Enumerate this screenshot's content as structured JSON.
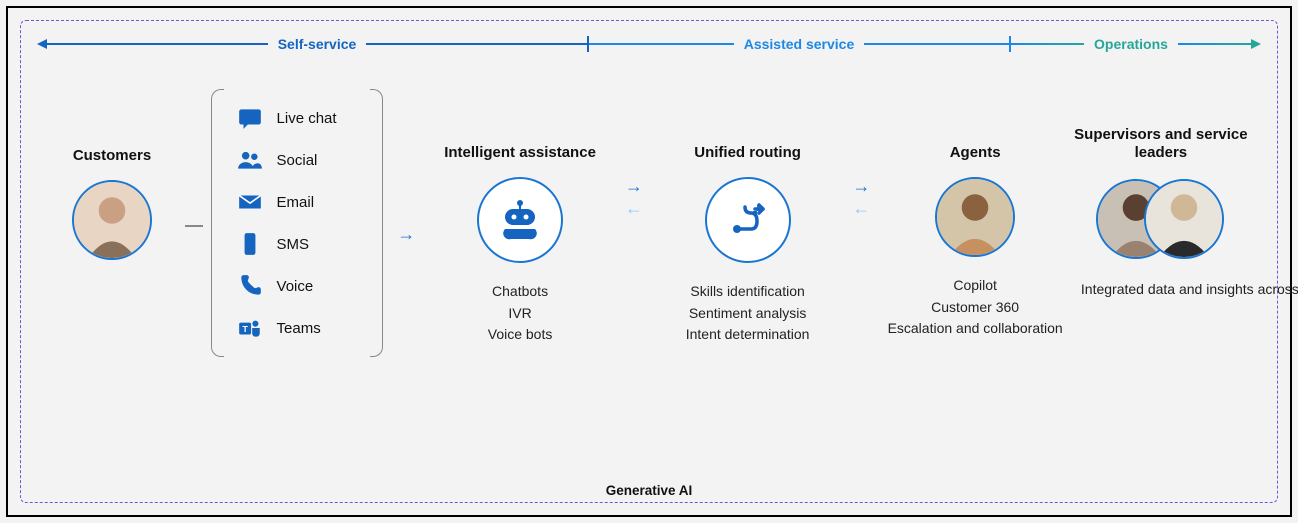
{
  "header": {
    "self_service": "Self-service",
    "assisted_service": "Assisted service",
    "operations": "Operations"
  },
  "customers": {
    "title": "Customers"
  },
  "channels": [
    {
      "icon": "chat-icon",
      "label": "Live chat"
    },
    {
      "icon": "people-icon",
      "label": "Social"
    },
    {
      "icon": "mail-icon",
      "label": "Email"
    },
    {
      "icon": "phone-sms-icon",
      "label": "SMS"
    },
    {
      "icon": "phone-icon",
      "label": "Voice"
    },
    {
      "icon": "teams-icon",
      "label": "Teams"
    }
  ],
  "assistance": {
    "title": "Intelligent assistance",
    "items": [
      "Chatbots",
      "IVR",
      "Voice bots"
    ]
  },
  "routing": {
    "title": "Unified routing",
    "items": [
      "Skills identification",
      "Sentiment analysis",
      "Intent determination"
    ]
  },
  "agents": {
    "title": "Agents",
    "items": [
      "Copilot",
      "Customer 360",
      "Escalation and collaboration"
    ]
  },
  "supervisors": {
    "title": "Supervisors and service leaders",
    "desc": "Integrated data and insights across disparate systems"
  },
  "footer": "Generative AI"
}
